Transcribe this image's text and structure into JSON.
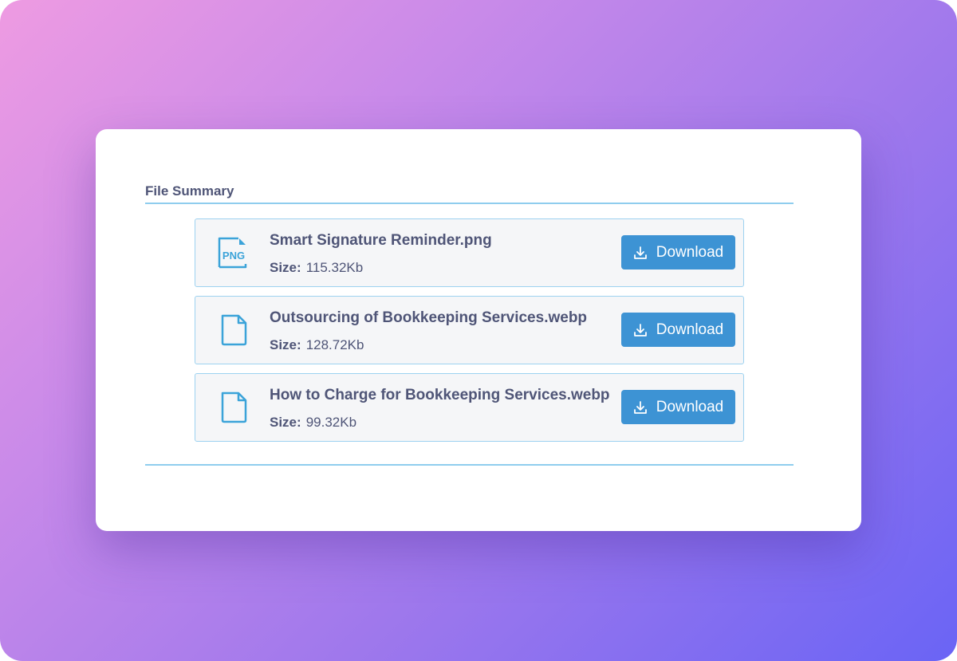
{
  "section": {
    "title": "File Summary"
  },
  "files": [
    {
      "icon": "png-file-icon",
      "icon_text": "PNG",
      "name": "Smart Signature Reminder.png",
      "size_label": "Size:",
      "size_value": "115.32Kb",
      "button_label": "Download"
    },
    {
      "icon": "file-icon",
      "name": "Outsourcing of Bookkeeping Services.webp",
      "size_label": "Size:",
      "size_value": "128.72Kb",
      "button_label": "Download"
    },
    {
      "icon": "file-icon",
      "name": "How to Charge for Bookkeeping Services.webp",
      "size_label": "Size:",
      "size_value": "99.32Kb",
      "button_label": "Download"
    }
  ],
  "colors": {
    "accent": "#3d93d4",
    "divider": "#8fcdee",
    "text": "#4f5577",
    "row_background": "#f5f6f8",
    "row_border": "#9dd2f0"
  }
}
